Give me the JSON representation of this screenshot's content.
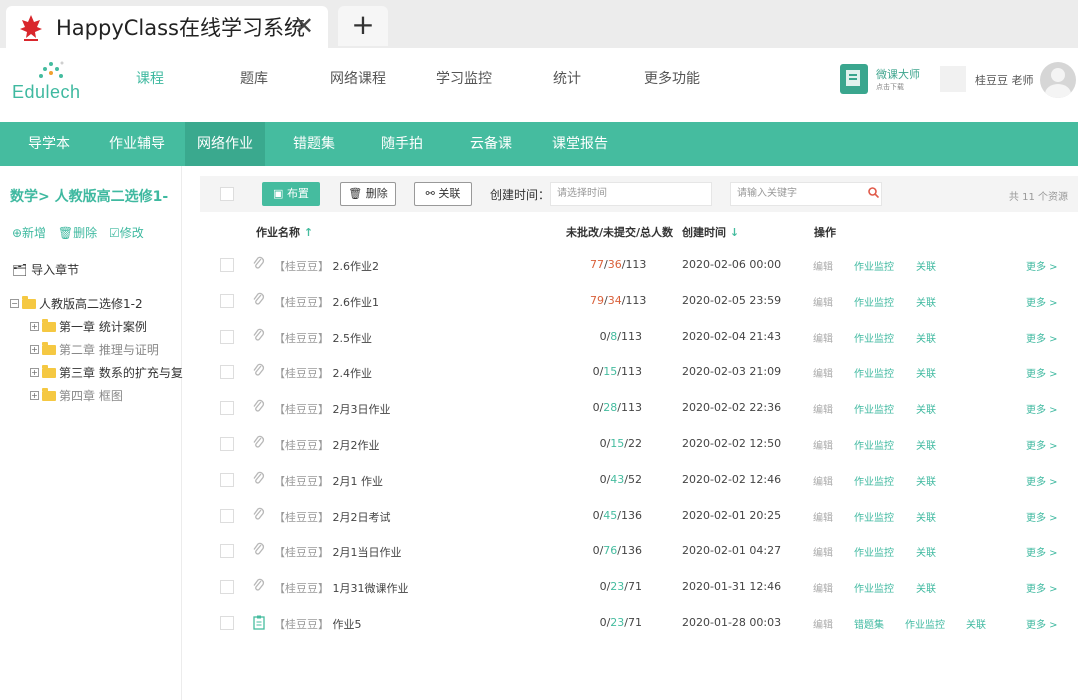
{
  "browser": {
    "tab_title": "HappyClass在线学习系统",
    "close_glyph": "✕",
    "new_tab_glyph": "+",
    "logo_icon": "maple-leaf-icon"
  },
  "brand": {
    "logo_text": "Edulech",
    "accent_color": "#45bc9f"
  },
  "topnav": {
    "items": [
      "课程",
      "题库",
      "网络课程",
      "学习监控",
      "统计",
      "更多功能"
    ],
    "active_index": 0
  },
  "wkds": {
    "title": "微课大师",
    "subtitle": "点击下载"
  },
  "user": {
    "name": "桂豆豆 老师"
  },
  "subnav": {
    "items": [
      "导学本",
      "作业辅导",
      "网络作业",
      "错题集",
      "随手拍",
      "云备课",
      "课堂报告"
    ],
    "active_index": 2
  },
  "sidebar": {
    "title": "数学> 人教版高二选修1-",
    "actions": [
      "⊕新增",
      "🗑删除",
      "☑修改"
    ],
    "import_label": "导入章节",
    "tree": {
      "root": "人教版高二选修1-2",
      "children": [
        "第一章 统计案例",
        "第二章 推理与证明",
        "第三章 数系的扩充与复",
        "第四章 框图"
      ]
    }
  },
  "toolbar": {
    "assign_label": "布置",
    "delete_label": "删除",
    "link_label": "关联",
    "date_label": "创建时间：",
    "date_placeholder": "请选择时间",
    "search_placeholder": "请输入关键字",
    "total_text": "共 11 个资源"
  },
  "table": {
    "headers": {
      "name": "作业名称",
      "name_sort": "↑",
      "counts": "未批改/未提交/总人数",
      "created": "创建时间",
      "created_sort": "↓",
      "ops": "操作"
    },
    "op_labels": {
      "edit": "编辑",
      "monitor": "作业监控",
      "link": "关联",
      "more": "更多 >",
      "mistakes": "错题集"
    },
    "rows": [
      {
        "owner": "【桂豆豆】",
        "name": "2.6作业2",
        "unreviewed": "77",
        "unsubmitted": "36",
        "total": "113",
        "created": "2020-02-06 00:00",
        "icon": "paperclip-icon",
        "has_mistakes": false
      },
      {
        "owner": "【桂豆豆】",
        "name": "2.6作业1",
        "unreviewed": "79",
        "unsubmitted": "34",
        "total": "113",
        "created": "2020-02-05 23:59",
        "icon": "paperclip-icon",
        "has_mistakes": false
      },
      {
        "owner": "【桂豆豆】",
        "name": "2.5作业",
        "unreviewed": "0",
        "unsubmitted": "8",
        "total": "113",
        "created": "2020-02-04 21:43",
        "icon": "paperclip-icon",
        "has_mistakes": false
      },
      {
        "owner": "【桂豆豆】",
        "name": "2.4作业",
        "unreviewed": "0",
        "unsubmitted": "15",
        "total": "113",
        "created": "2020-02-03 21:09",
        "icon": "paperclip-icon",
        "has_mistakes": false
      },
      {
        "owner": "【桂豆豆】",
        "name": "2月3日作业",
        "unreviewed": "0",
        "unsubmitted": "28",
        "total": "113",
        "created": "2020-02-02 22:36",
        "icon": "paperclip-icon",
        "has_mistakes": false
      },
      {
        "owner": "【桂豆豆】",
        "name": "2月2作业",
        "unreviewed": "0",
        "unsubmitted": "15",
        "total": "22",
        "created": "2020-02-02 12:50",
        "icon": "paperclip-icon",
        "has_mistakes": false
      },
      {
        "owner": "【桂豆豆】",
        "name": "2月1 作业",
        "unreviewed": "0",
        "unsubmitted": "43",
        "total": "52",
        "created": "2020-02-02 12:46",
        "icon": "paperclip-icon",
        "has_mistakes": false
      },
      {
        "owner": "【桂豆豆】",
        "name": "2月2日考试",
        "unreviewed": "0",
        "unsubmitted": "45",
        "total": "136",
        "created": "2020-02-01 20:25",
        "icon": "paperclip-icon",
        "has_mistakes": false
      },
      {
        "owner": "【桂豆豆】",
        "name": "2月1当日作业",
        "unreviewed": "0",
        "unsubmitted": "76",
        "total": "136",
        "created": "2020-02-01 04:27",
        "icon": "paperclip-icon",
        "has_mistakes": false
      },
      {
        "owner": "【桂豆豆】",
        "name": "1月31微课作业",
        "unreviewed": "0",
        "unsubmitted": "23",
        "total": "71",
        "created": "2020-01-31 12:46",
        "icon": "paperclip-icon",
        "has_mistakes": false
      },
      {
        "owner": "【桂豆豆】",
        "name": "作业5",
        "unreviewed": "0",
        "unsubmitted": "23",
        "total": "71",
        "created": "2020-01-28 00:03",
        "icon": "clipboard-icon",
        "has_mistakes": true
      }
    ]
  }
}
